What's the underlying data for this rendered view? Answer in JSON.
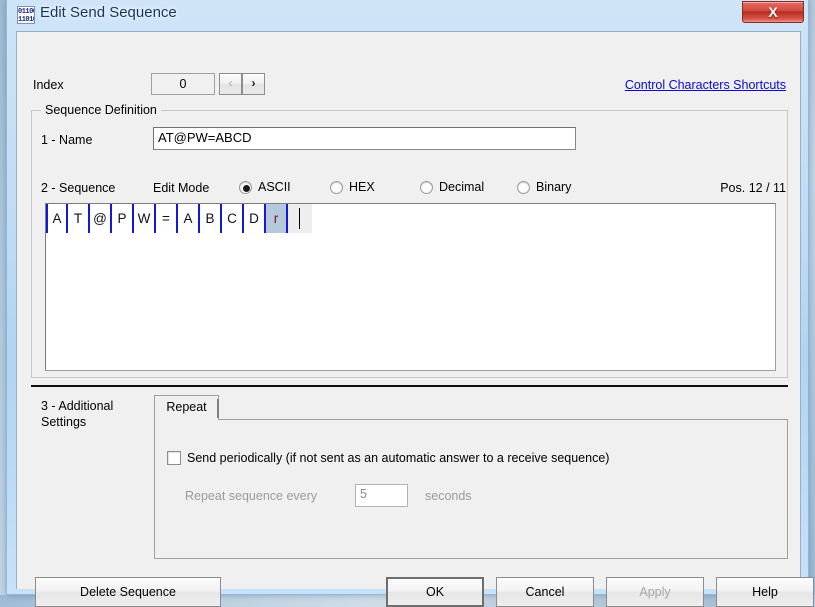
{
  "window": {
    "title": "Edit Send Sequence",
    "icon": "binary-app-icon",
    "icon_glyph_top": "01100",
    "icon_glyph_bottom": "11010",
    "close_label": "X",
    "accent_link_color": "#0a0ad0",
    "selection_color": "#b6c8dc",
    "cell_separator_color": "#1418d8"
  },
  "index_row": {
    "label": "Index",
    "value": "0",
    "prev_label": "‹",
    "next_label": "›",
    "shortcut_link": "Control Characters Shortcuts"
  },
  "sequence_definition": {
    "legend": "Sequence Definition",
    "name_label": "1 - Name",
    "name_value": "AT@PW=ABCD",
    "sequence_label": "2 - Sequence",
    "edit_mode_label": "Edit Mode",
    "edit_mode_selected": "ASCII",
    "edit_modes": [
      {
        "label": "ASCII",
        "selected": true
      },
      {
        "label": "HEX",
        "selected": false
      },
      {
        "label": "Decimal",
        "selected": false
      },
      {
        "label": "Binary",
        "selected": false
      }
    ],
    "position_label": "Pos. 12 / 11",
    "cells": [
      {
        "char": "A",
        "selected": false
      },
      {
        "char": "T",
        "selected": false
      },
      {
        "char": "@",
        "selected": false
      },
      {
        "char": "P",
        "selected": false
      },
      {
        "char": "W",
        "selected": false
      },
      {
        "char": "=",
        "selected": false
      },
      {
        "char": "A",
        "selected": false
      },
      {
        "char": "B",
        "selected": false
      },
      {
        "char": "C",
        "selected": false
      },
      {
        "char": "D",
        "selected": false
      },
      {
        "char": "r",
        "selected": true
      }
    ],
    "caret_cell": ""
  },
  "additional_settings": {
    "label_line1": "3 - Additional",
    "label_line2": "Settings",
    "tab_label": "Repeat",
    "send_periodically_label": "Send periodically  (if not sent as an automatic answer to a receive sequence)",
    "send_periodically_checked": false,
    "repeat_every_label": "Repeat sequence every",
    "repeat_value": "5",
    "seconds_label": "seconds",
    "disabled": true
  },
  "buttons": {
    "delete": "Delete Sequence",
    "ok": "OK",
    "cancel": "Cancel",
    "apply": "Apply",
    "apply_disabled": true,
    "help": "Help"
  }
}
